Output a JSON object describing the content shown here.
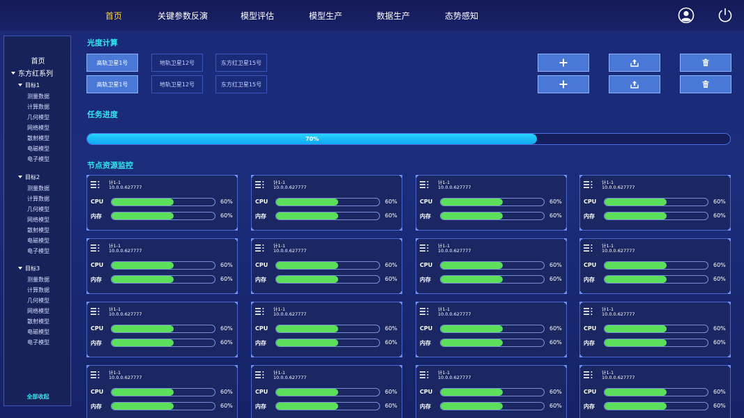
{
  "nav": {
    "items": [
      {
        "label": "首页",
        "active": true
      },
      {
        "label": "关键参数反演",
        "active": false
      },
      {
        "label": "模型评估",
        "active": false
      },
      {
        "label": "模型生产",
        "active": false
      },
      {
        "label": "数据生产",
        "active": false
      },
      {
        "label": "态势感知",
        "active": false
      }
    ],
    "icons": [
      "user-icon",
      "power-icon"
    ]
  },
  "sidebar": {
    "home": "首页",
    "series": "东方红系列",
    "targets": [
      {
        "label": "目标1",
        "items": [
          "测量数据",
          "计算数据",
          "几何模型",
          "网络模型",
          "散射模型",
          "电磁模型",
          "电子模型"
        ]
      },
      {
        "label": "目标2",
        "items": [
          "测量数据",
          "计算数据",
          "几何模型",
          "网络模型",
          "散射模型",
          "电磁模型",
          "电子模型"
        ]
      },
      {
        "label": "目标3",
        "items": [
          "测量数据",
          "计算数据",
          "几何模型",
          "网络模型",
          "散射模型",
          "电磁模型",
          "电子模型"
        ]
      }
    ],
    "collapse_all": "全部收起"
  },
  "photometry": {
    "title": "光度计算",
    "rows": [
      [
        "高轨卫星1号",
        "地轨卫星12号",
        "东方红卫星15号"
      ],
      [
        "高轨卫星1号",
        "地轨卫星12号",
        "东方红卫星15号"
      ]
    ],
    "selected_index": 0,
    "actions": [
      "plus-icon",
      "upload-icon",
      "trash-icon"
    ]
  },
  "task": {
    "title": "任务进度",
    "progress": 0.7,
    "progress_label": "70%"
  },
  "monitor": {
    "title": "节点资源监控",
    "cpu_label": "CPU",
    "mem_label": "内存",
    "nodes": [
      {
        "name": "计1-1",
        "ip": "10.0.0.627777",
        "cpu": 0.6,
        "cpu_label": "60%",
        "mem": 0.6,
        "mem_label": "60%"
      },
      {
        "name": "计1-1",
        "ip": "10.0.0.627777",
        "cpu": 0.6,
        "cpu_label": "60%",
        "mem": 0.6,
        "mem_label": "60%"
      },
      {
        "name": "计1-1",
        "ip": "10.0.0.627777",
        "cpu": 0.6,
        "cpu_label": "60%",
        "mem": 0.6,
        "mem_label": "60%"
      },
      {
        "name": "计1-1",
        "ip": "10.0.0.627777",
        "cpu": 0.6,
        "cpu_label": "60%",
        "mem": 0.6,
        "mem_label": "60%"
      },
      {
        "name": "计1-1",
        "ip": "10.0.0.627777",
        "cpu": 0.6,
        "cpu_label": "60%",
        "mem": 0.6,
        "mem_label": "60%"
      },
      {
        "name": "计1-1",
        "ip": "10.0.0.627777",
        "cpu": 0.6,
        "cpu_label": "60%",
        "mem": 0.6,
        "mem_label": "60%"
      },
      {
        "name": "计1-1",
        "ip": "10.0.0.627777",
        "cpu": 0.6,
        "cpu_label": "60%",
        "mem": 0.6,
        "mem_label": "60%"
      },
      {
        "name": "计1-1",
        "ip": "10.0.0.627777",
        "cpu": 0.6,
        "cpu_label": "60%",
        "mem": 0.6,
        "mem_label": "60%"
      },
      {
        "name": "计1-1",
        "ip": "10.0.0.627777",
        "cpu": 0.6,
        "cpu_label": "60%",
        "mem": 0.6,
        "mem_label": "60%"
      },
      {
        "name": "计1-1",
        "ip": "10.0.0.627777",
        "cpu": 0.6,
        "cpu_label": "60%",
        "mem": 0.6,
        "mem_label": "60%"
      },
      {
        "name": "计1-1",
        "ip": "10.0.0.627777",
        "cpu": 0.6,
        "cpu_label": "60%",
        "mem": 0.6,
        "mem_label": "60%"
      },
      {
        "name": "计1-1",
        "ip": "10.0.0.627777",
        "cpu": 0.6,
        "cpu_label": "60%",
        "mem": 0.6,
        "mem_label": "60%"
      },
      {
        "name": "计1-1",
        "ip": "10.0.0.627777",
        "cpu": 0.6,
        "cpu_label": "60%",
        "mem": 0.6,
        "mem_label": "60%"
      },
      {
        "name": "计1-1",
        "ip": "10.0.0.627777",
        "cpu": 0.6,
        "cpu_label": "60%",
        "mem": 0.6,
        "mem_label": "60%"
      },
      {
        "name": "计1-1",
        "ip": "10.0.0.627777",
        "cpu": 0.6,
        "cpu_label": "60%",
        "mem": 0.6,
        "mem_label": "60%"
      },
      {
        "name": "计1-1",
        "ip": "10.0.0.627777",
        "cpu": 0.6,
        "cpu_label": "60%",
        "mem": 0.6,
        "mem_label": "60%"
      }
    ]
  },
  "colors": {
    "accent_cyan": "#31e6f0",
    "active_nav": "#ffd23a",
    "progress": "#10a6f0",
    "metric_fill": "#5ce05c",
    "button_blue": "#4a78d6"
  }
}
